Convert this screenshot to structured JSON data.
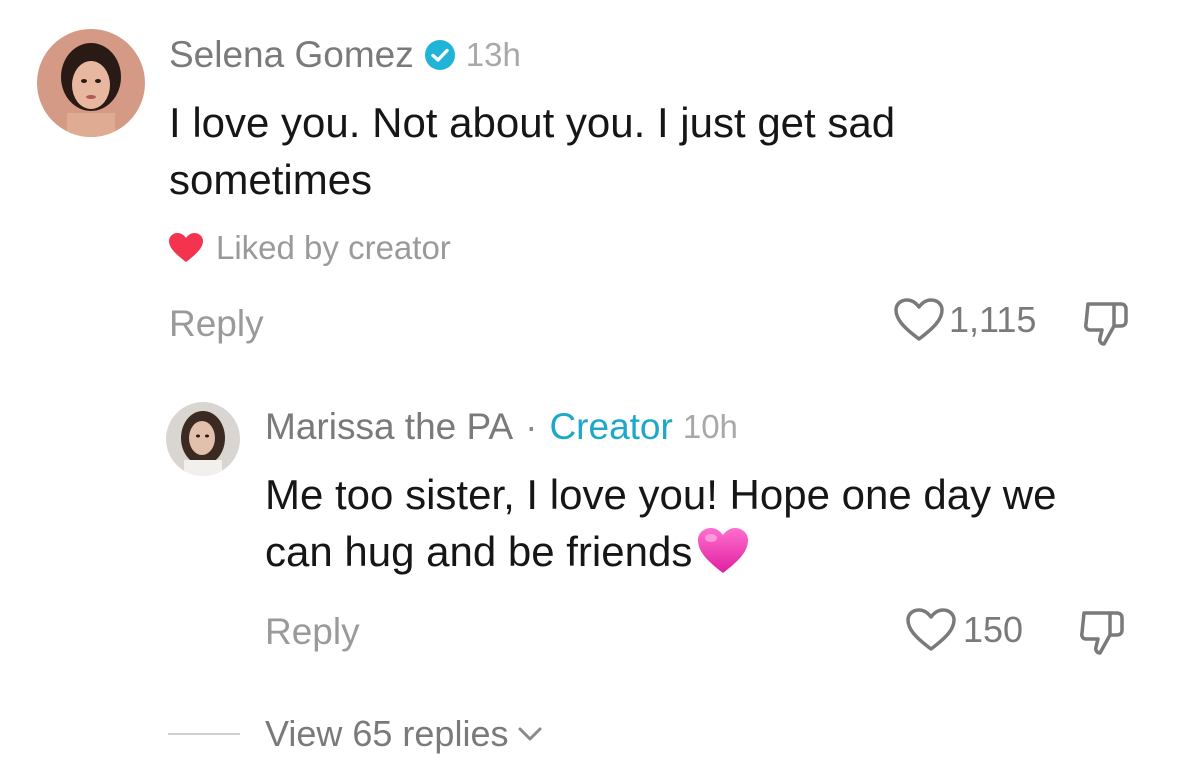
{
  "comment": {
    "username": "Selena Gomez",
    "verified": true,
    "time": "13h",
    "text": "I love you. Not about you. I just get sad sometimes",
    "liked_by_label": "Liked by creator",
    "reply_label": "Reply",
    "like_count": "1,115"
  },
  "reply": {
    "username": "Marissa the PA",
    "separator": "·",
    "creator_label": "Creator",
    "time": "10h",
    "text": "Me too sister, I love you! Hope one day we can hug and be friends",
    "emoji": "💗",
    "reply_label": "Reply",
    "like_count": "150"
  },
  "view_replies_label": "View 65 replies",
  "colors": {
    "verified_badge": "#20b4d8",
    "creator_tag": "#1da7c9",
    "liked_heart": "#f4344f",
    "text_primary": "#161616",
    "text_secondary": "#7a7a7a"
  }
}
